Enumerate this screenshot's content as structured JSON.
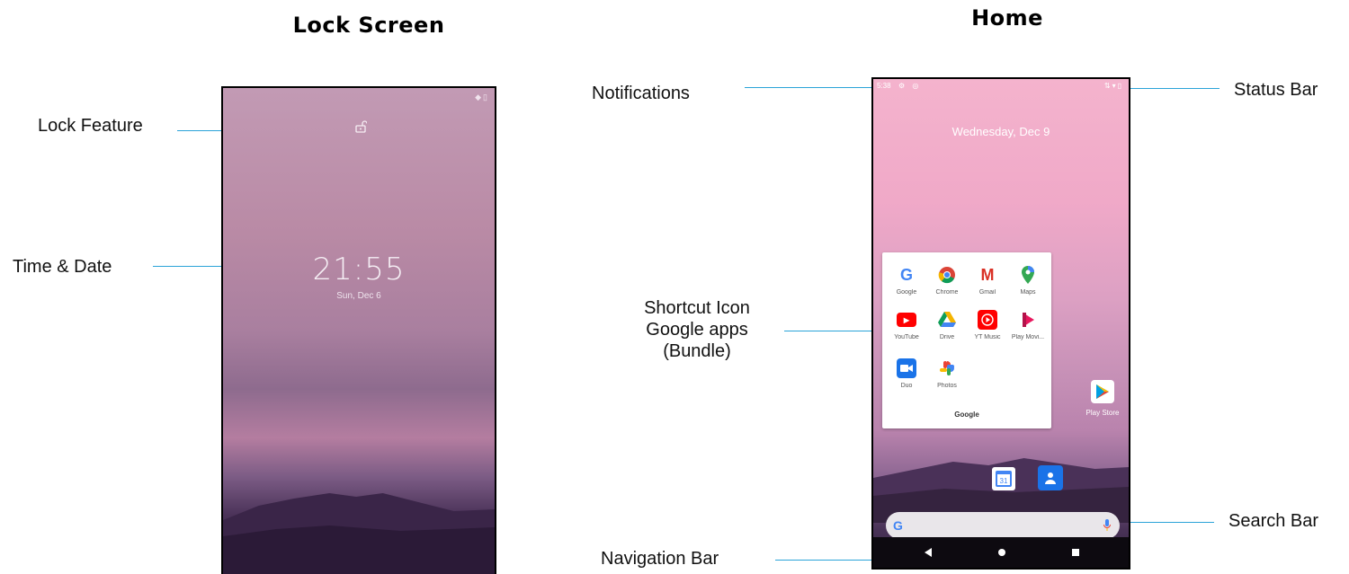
{
  "headings": {
    "lock": "Lock Screen",
    "home": "Home"
  },
  "labels": {
    "lock_feature": "Lock Feature",
    "time_date": "Time & Date",
    "notifications": "Notifications",
    "shortcut_line1": "Shortcut Icon",
    "shortcut_line2": "Google apps",
    "shortcut_line3": "(Bundle)",
    "navigation_bar": "Navigation Bar",
    "status_bar": "Status Bar",
    "search_bar": "Search Bar"
  },
  "lock_screen": {
    "time": "21:55",
    "date": "Sun, Dec 6"
  },
  "home_screen": {
    "status_time": "5:38",
    "date": "Wednesday, Dec 9",
    "folder": {
      "name": "Google",
      "apps": [
        {
          "name": "Google",
          "icon": "google-icon"
        },
        {
          "name": "Chrome",
          "icon": "chrome-icon"
        },
        {
          "name": "Gmail",
          "icon": "gmail-icon"
        },
        {
          "name": "Maps",
          "icon": "maps-icon"
        },
        {
          "name": "YouTube",
          "icon": "youtube-icon"
        },
        {
          "name": "Drive",
          "icon": "drive-icon"
        },
        {
          "name": "YT Music",
          "icon": "yt-music-icon"
        },
        {
          "name": "Play Movi...",
          "icon": "play-movies-icon"
        },
        {
          "name": "Duo",
          "icon": "duo-icon"
        },
        {
          "name": "Photos",
          "icon": "photos-icon"
        }
      ]
    },
    "play_store": "Play Store",
    "calendar_day": "31"
  },
  "colors": {
    "leader": "#2aa3d8",
    "google_blue": "#4285f4"
  }
}
